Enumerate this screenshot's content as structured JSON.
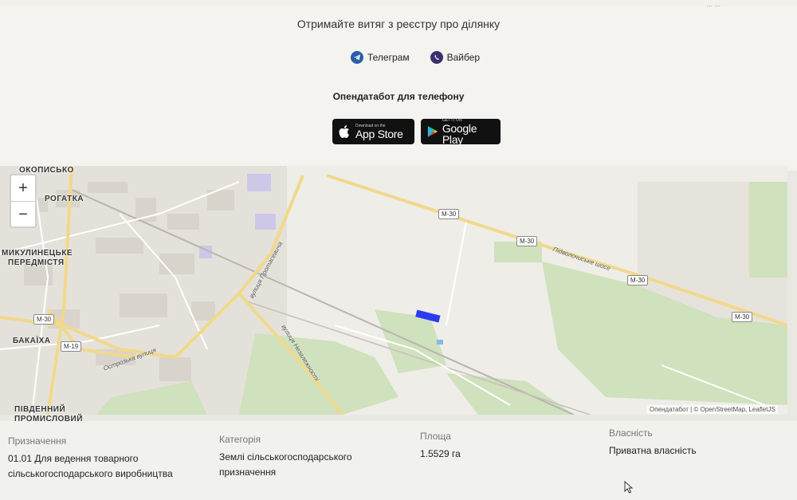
{
  "top_note": "... ...",
  "promo": {
    "title": "Отримайте витяг з реєстру про ділянку",
    "telegram_label": "Телеграм",
    "viber_label": "Вайбер",
    "apps_title": "Опендатабот для телефону",
    "app_store_small": "Download on the",
    "app_store_label": "App Store",
    "google_play_small": "GET IT ON",
    "google_play_label": "Google Play"
  },
  "map": {
    "zoom_in": "+",
    "zoom_out": "−",
    "places": {
      "okopysko": "ОКОПИСЬКО",
      "rogatka": "РОГАТКА",
      "mykulyntsi_1": "МИКУЛИНЕЦЬКЕ",
      "mykulyntsi_2": "ПЕРЕДМІСТЯ",
      "bakaikha": "БАКАЇХА",
      "pivdennyi_1": "ПІВДЕННИЙ",
      "pivdennyi_2": "ПРОМИСЛОВИЙ"
    },
    "roads": {
      "pidvolochyske": "Підволочиське шосе",
      "protasevycha": "вулиця Протасевича",
      "nezalezhnosti": "вулиця Незалежності",
      "ostrozka": "Острозька вулиця"
    },
    "shields": {
      "m30": "М-30",
      "m19": "М-19"
    },
    "attribution": {
      "opendatabot": "Опендатабот",
      "sep": " | © ",
      "osm": "OpenStreetMap",
      "sep2": ", ",
      "leaflet": "LeafletJS"
    }
  },
  "details": {
    "purpose_label": "Призначення",
    "purpose_value_1": "01.01 Для ведення товарного",
    "purpose_value_2": "сільськогосподарського виробництва",
    "category_label": "Категорія",
    "category_value_1": "Землі сільськогосподарського",
    "category_value_2": "призначення",
    "area_label": "Площа",
    "area_value": "1.5529 га",
    "ownership_label": "Власність",
    "ownership_value": "Приватна власність"
  },
  "colors": {
    "parcel": "#2b3cf0",
    "road_major": "#f1d98a",
    "green_area": "#cfe1bd"
  }
}
